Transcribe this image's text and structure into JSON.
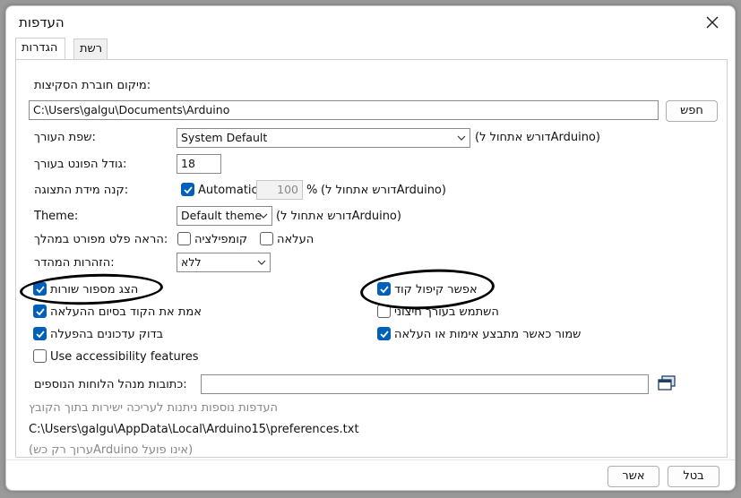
{
  "window": {
    "title": "העדפות"
  },
  "tabs": [
    {
      "label": "הגדרות",
      "active": true
    },
    {
      "label": "רשת",
      "active": false
    }
  ],
  "sketchbook": {
    "label": "מיקום חוברת הסקיצות:",
    "value": "C:\\Users\\galgu\\Documents\\Arduino",
    "browse_label": "חפש"
  },
  "editor_language": {
    "label": "שפת העורך:",
    "value": "System Default",
    "note": "(דורש אתחול לArduino)"
  },
  "font_size": {
    "label": "גודל הפונט בעורך:",
    "value": "18"
  },
  "interface_scale": {
    "label": "קנה מידת התצוגה:",
    "automatic_label": "Automatic",
    "automatic_checked": true,
    "value": "100",
    "unit": "%",
    "note": "(דורש אתחול לArduino)"
  },
  "theme": {
    "label": "Theme:",
    "value": "Default theme",
    "note": "(דורש אתחול לArduino)"
  },
  "verbose": {
    "label": "הראה פלט מפורט במהלך:",
    "compile_label": "קומפילציה",
    "compile_checked": false,
    "upload_label": "העלאה",
    "upload_checked": false
  },
  "compiler_warnings": {
    "label": "הזהרות המהדר:",
    "value": "ללא"
  },
  "checkboxes_left": [
    {
      "label": "הצג מספור שורות",
      "checked": true
    },
    {
      "label": "אמת את הקוד בסיום ההעלאה",
      "checked": true
    },
    {
      "label": "בדוק עדכונים בהפעלה",
      "checked": true
    },
    {
      "label": "Use accessibility features",
      "checked": false
    }
  ],
  "checkboxes_right": [
    {
      "label": "אפשר קיפול קוד",
      "checked": true
    },
    {
      "label": "השתמש בעורך חיצוני",
      "checked": false
    },
    {
      "label": "שמור כאשר מתבצע אימות או העלאה",
      "checked": true
    }
  ],
  "board_urls": {
    "label": "כתובות מנהל הלוחות הנוספים:",
    "value": ""
  },
  "more_prefs_note": "העדפות נוספות ניתנות לעריכה ישירות בתוך הקובץ",
  "prefs_path": "C:\\Users\\galgu\\AppData\\Local\\Arduino15\\preferences.txt",
  "edit_note": "(ערוך רק כשArduino אינו פועל)",
  "footer": {
    "ok_label": "אשר",
    "cancel_label": "בטל"
  },
  "colors": {
    "accent": "#005fb8",
    "annotation": "#000000"
  }
}
